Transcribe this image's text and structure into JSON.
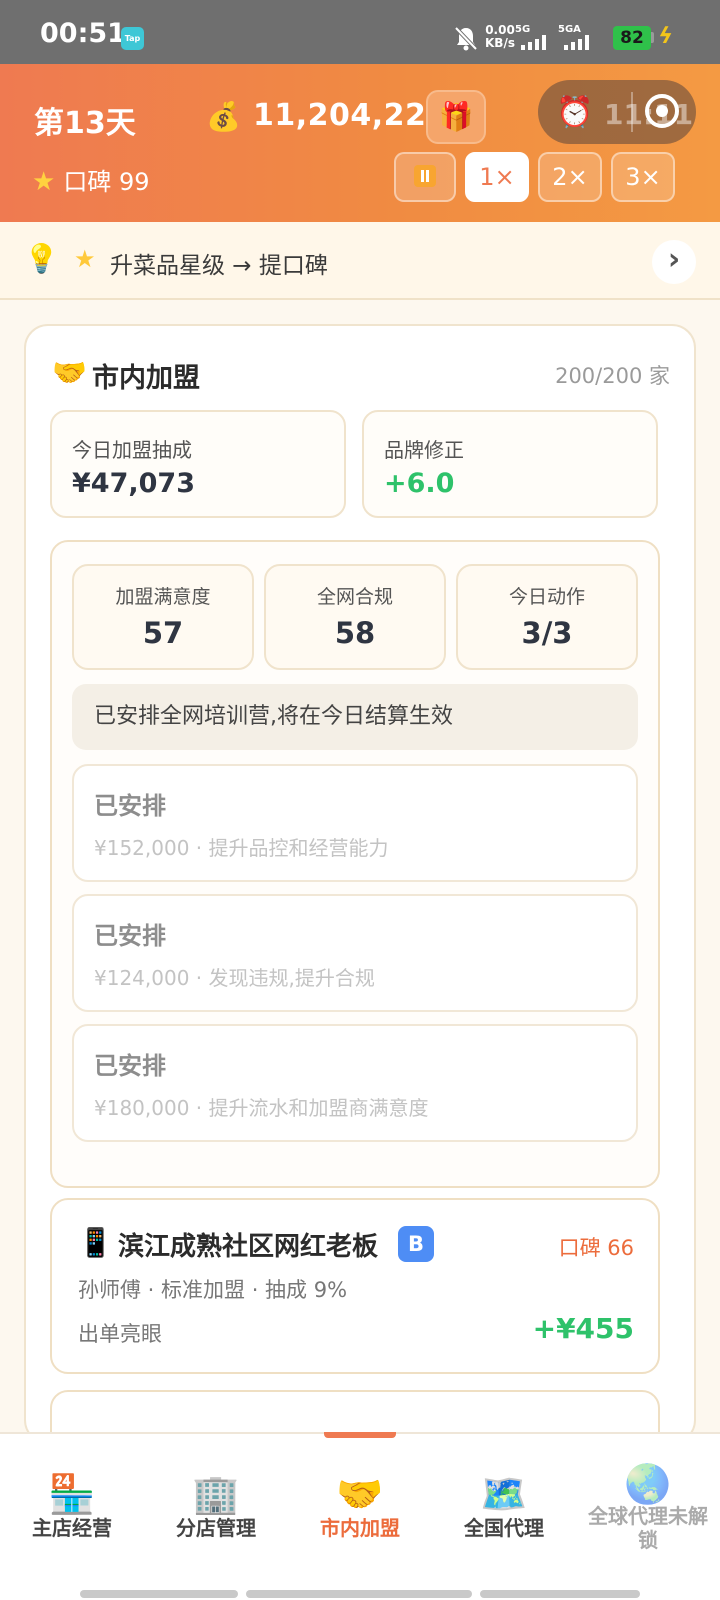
{
  "status_bar": {
    "time": "00:51",
    "app_badge": "Tap",
    "net_speed_top": "0.00",
    "net_speed_unit": "KB/s",
    "sig1_label": "5G",
    "sig2_label": "5GA",
    "battery": "82"
  },
  "header": {
    "day": "第13天",
    "money": "11,204,224",
    "timer_text": "11:11",
    "rating_label": "口碑 99",
    "speed_buttons": [
      "1×",
      "2×",
      "3×"
    ],
    "active_speed": "1×"
  },
  "tip": {
    "text": "升菜品星级 → 提口碑"
  },
  "franchise": {
    "title": "市内加盟",
    "count": "200/200 家",
    "commission_label": "今日加盟抽成",
    "commission_value": "¥47,073",
    "brand_label": "品牌修正",
    "brand_value": "+6.0",
    "metrics": [
      {
        "label": "加盟满意度",
        "value": "57"
      },
      {
        "label": "全网合规",
        "value": "58"
      },
      {
        "label": "今日动作",
        "value": "3/3"
      }
    ],
    "notice": "已安排全网培训营,将在今日结算生效",
    "actions": [
      {
        "title": "已安排",
        "cost": "¥152,000",
        "desc": "提升品控和经营能力"
      },
      {
        "title": "已安排",
        "cost": "¥124,000",
        "desc": "发现违规,提升合规"
      },
      {
        "title": "已安排",
        "cost": "¥180,000",
        "desc": "提升流水和加盟商满意度"
      }
    ],
    "shop": {
      "name": "滨江成熟社区网红老板",
      "badge": "B",
      "rating": "口碑 66",
      "meta": "孙师傅 · 标准加盟 · 抽成 9%",
      "note": "出单亮眼",
      "income": "+¥455"
    }
  },
  "bottom_nav": [
    {
      "label": "主店经营",
      "icon": "convenience-store-icon"
    },
    {
      "label": "分店管理",
      "icon": "office-building-icon"
    },
    {
      "label": "市内加盟",
      "icon": "handshake-icon"
    },
    {
      "label": "全国代理",
      "icon": "map-icon"
    },
    {
      "label": "全球代理未解锁",
      "icon": "globe-icon"
    }
  ],
  "colors": {
    "header_orange": "#ef7a51",
    "accent_green": "#2ec26a",
    "badge_blue": "#4e8df5"
  }
}
